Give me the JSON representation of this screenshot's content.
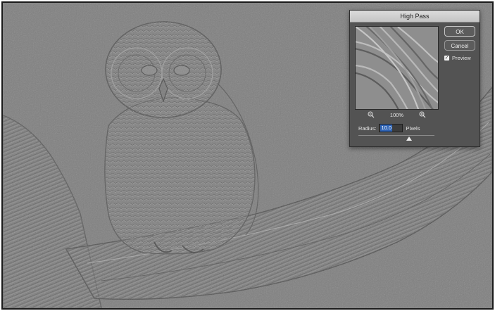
{
  "dialog": {
    "title": "High Pass",
    "ok_label": "OK",
    "cancel_label": "Cancel",
    "preview_label": "Preview",
    "preview_checked": true,
    "zoom_level": "100%",
    "radius_label": "Radius:",
    "radius_value": "10.0",
    "radius_unit": "Pixels",
    "radius_slider_fraction": 0.0385
  },
  "canvas": {
    "image_subject": "owl-on-branch",
    "background_color": "#7f7f7f"
  }
}
